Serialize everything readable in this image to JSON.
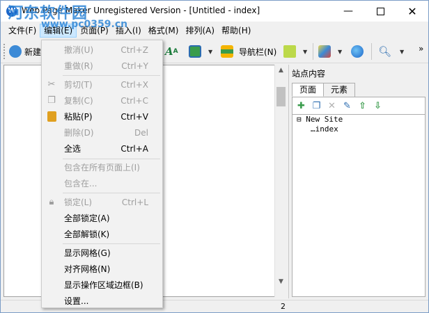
{
  "window": {
    "title": "Web Page Maker Unregistered Version - [Untitled - index]",
    "app_icon": "app-logo-icon",
    "controls": [
      "minimize-icon",
      "maximize-icon",
      "close-icon"
    ]
  },
  "watermark": {
    "text": "河东软件园",
    "url": "www.pc0359.cn"
  },
  "menubar": {
    "items": [
      "文件(F)",
      "编辑(E)",
      "页面(P)",
      "插入(I)",
      "格式(M)",
      "排列(A)",
      "帮助(H)"
    ],
    "active": "编辑(E)"
  },
  "toolbar": {
    "new_label": "新建",
    "nav_label": "导航栏(N)",
    "more": "»"
  },
  "edit_menu": [
    {
      "label": "撤消(U)",
      "shortcut": "Ctrl+Z",
      "disabled": true
    },
    {
      "label": "重做(R)",
      "shortcut": "Ctrl+Y",
      "disabled": true
    },
    {
      "label": "剪切(T)",
      "shortcut": "Ctrl+X",
      "disabled": true,
      "icon": "scissors-icon"
    },
    {
      "label": "复制(C)",
      "shortcut": "Ctrl+C",
      "disabled": true,
      "icon": "copy-icon"
    },
    {
      "label": "粘贴(P)",
      "shortcut": "Ctrl+V",
      "disabled": false,
      "icon": "paste-icon"
    },
    {
      "label": "删除(D)",
      "shortcut": "Del",
      "disabled": true
    },
    {
      "label": "全选",
      "shortcut": "Ctrl+A",
      "disabled": false
    },
    {
      "label": "包含在所有页面上(I)",
      "shortcut": "",
      "disabled": true
    },
    {
      "label": "包含在...",
      "shortcut": "",
      "disabled": true
    },
    {
      "label": "锁定(L)",
      "shortcut": "Ctrl+L",
      "disabled": true,
      "icon": "lock-icon"
    },
    {
      "label": "全部锁定(A)",
      "shortcut": "",
      "disabled": false
    },
    {
      "label": "全部解锁(K)",
      "shortcut": "",
      "disabled": false
    },
    {
      "label": "显示网格(G)",
      "shortcut": "",
      "disabled": false
    },
    {
      "label": "对齐网格(N)",
      "shortcut": "",
      "disabled": false
    },
    {
      "label": "显示操作区域边框(B)",
      "shortcut": "",
      "disabled": false
    },
    {
      "label": "设置...",
      "shortcut": "",
      "disabled": false
    }
  ],
  "site_panel": {
    "title": "站点内容",
    "tabs": [
      "页面",
      "元素"
    ],
    "tree": {
      "root": "New Site",
      "child": "index"
    }
  },
  "status": {
    "text": "2"
  }
}
